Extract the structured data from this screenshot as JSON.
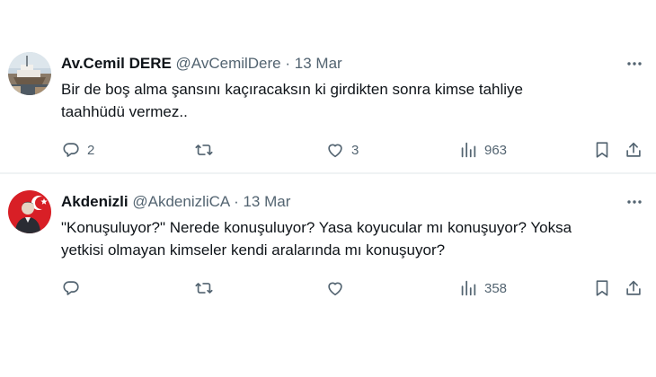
{
  "tweets": [
    {
      "name": "Av.Cemil DERE",
      "handle": "@AvCemilDere",
      "dot": "·",
      "date": "13 Mar",
      "text_line1": "Bir de boş alma şansını kaçıracaksın ki girdikten sonra kimse tahliye",
      "text_line2": "taahhüdü vermez..",
      "replies": "2",
      "retweets": "",
      "likes": "3",
      "views": "963",
      "avatar_icon": "boat-photo-avatar"
    },
    {
      "name": "Akdenizli",
      "handle": "@AkdenizliCA",
      "dot": "·",
      "date": "13 Mar",
      "text_line1": "\"Konuşuluyor?\" Nerede konuşuluyor? Yasa koyucular mı konuşuyor? Yoksa",
      "text_line2": "yetkisi olmayan kimseler kendi aralarında mı konuşuyor?",
      "replies": "",
      "retweets": "",
      "likes": "",
      "views": "358",
      "avatar_icon": "flag-portrait-avatar"
    }
  ],
  "colors": {
    "text": "#0f1419",
    "secondary": "#536471",
    "divider": "#eff3f4",
    "flag_red": "#d81f26"
  },
  "icons": [
    "more-icon",
    "reply-icon",
    "retweet-icon",
    "like-icon",
    "views-icon",
    "bookmark-icon",
    "share-icon"
  ]
}
